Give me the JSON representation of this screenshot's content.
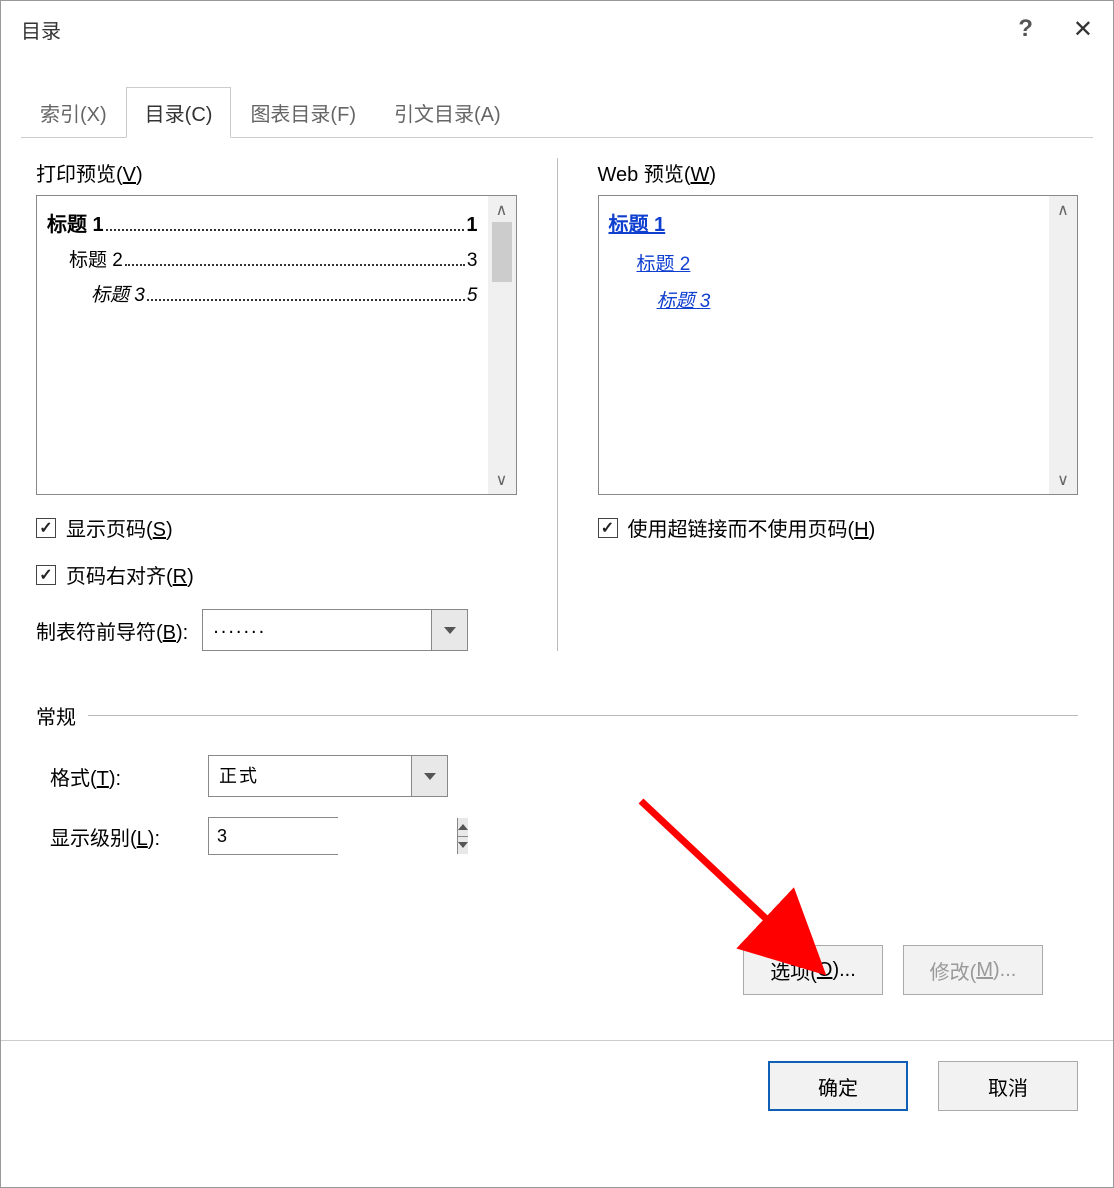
{
  "titlebar": {
    "title": "目录",
    "help": "?",
    "close": "✕"
  },
  "tabs": {
    "index": "索引(X)",
    "toc": "目录(C)",
    "figures": "图表目录(F)",
    "citations": "引文目录(A)"
  },
  "preview": {
    "print_label_pre": "打印预览(",
    "print_label_key": "V",
    "print_label_post": ")",
    "web_label_pre": "Web 预览(",
    "web_label_key": "W",
    "web_label_post": ")",
    "toc_entries": [
      {
        "title": "标题 1",
        "page": "1"
      },
      {
        "title": "标题 2",
        "page": "3"
      },
      {
        "title": "标题 3",
        "page": "5"
      }
    ],
    "web_entries": [
      "标题 1",
      "标题 2",
      "标题 3"
    ]
  },
  "options": {
    "show_page_numbers_pre": "显示页码(",
    "show_page_numbers_key": "S",
    "show_page_numbers_post": ")",
    "right_align_pre": "页码右对齐(",
    "right_align_key": "R",
    "right_align_post": ")",
    "use_hyperlinks_pre": "使用超链接而不使用页码(",
    "use_hyperlinks_key": "H",
    "use_hyperlinks_post": ")",
    "tab_leader_label_pre": "制表符前导符(",
    "tab_leader_label_key": "B",
    "tab_leader_label_post": "):",
    "tab_leader_value": "......."
  },
  "general": {
    "header": "常规",
    "format_label_pre": "格式(",
    "format_label_key": "T",
    "format_label_post": "):",
    "format_value": "正式",
    "levels_label_pre": "显示级别(",
    "levels_label_key": "L",
    "levels_label_post": "):",
    "levels_value": "3"
  },
  "buttons": {
    "options_pre": "选项(",
    "options_key": "O",
    "options_post": ")...",
    "modify_pre": "修改(",
    "modify_key": "M",
    "modify_post": ")...",
    "ok": "确定",
    "cancel": "取消"
  }
}
